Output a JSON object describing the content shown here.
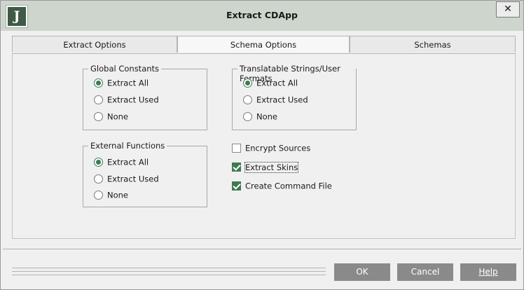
{
  "window": {
    "title": "Extract CDApp",
    "logo_letter": "J",
    "close_label": "✕"
  },
  "tabs": [
    {
      "label": "Extract Options"
    },
    {
      "label": "Schema Options"
    },
    {
      "label": "Schemas"
    }
  ],
  "groups": {
    "global_constants": {
      "title": "Global Constants",
      "options": [
        "Extract All",
        "Extract Used",
        "None"
      ],
      "selected": "Extract All"
    },
    "external_functions": {
      "title": "External Functions",
      "options": [
        "Extract All",
        "Extract Used",
        "None"
      ],
      "selected": "Extract All"
    },
    "translatable_strings": {
      "title": "Translatable Strings/User Formats",
      "options": [
        "Extract All",
        "Extract Used",
        "None"
      ],
      "selected": "Extract All"
    }
  },
  "checkboxes": {
    "encrypt_sources": {
      "label": "Encrypt Sources",
      "checked": false
    },
    "extract_skins": {
      "label": "Extract Skins",
      "checked": true
    },
    "create_command_file": {
      "label": "Create Command File",
      "checked": true
    }
  },
  "buttons": {
    "ok": "OK",
    "cancel": "Cancel",
    "help": "Help"
  },
  "colors": {
    "accent_green": "#3e7a4f",
    "titlebar": "#cdd5cd",
    "button_gray": "#8a8a8a"
  }
}
